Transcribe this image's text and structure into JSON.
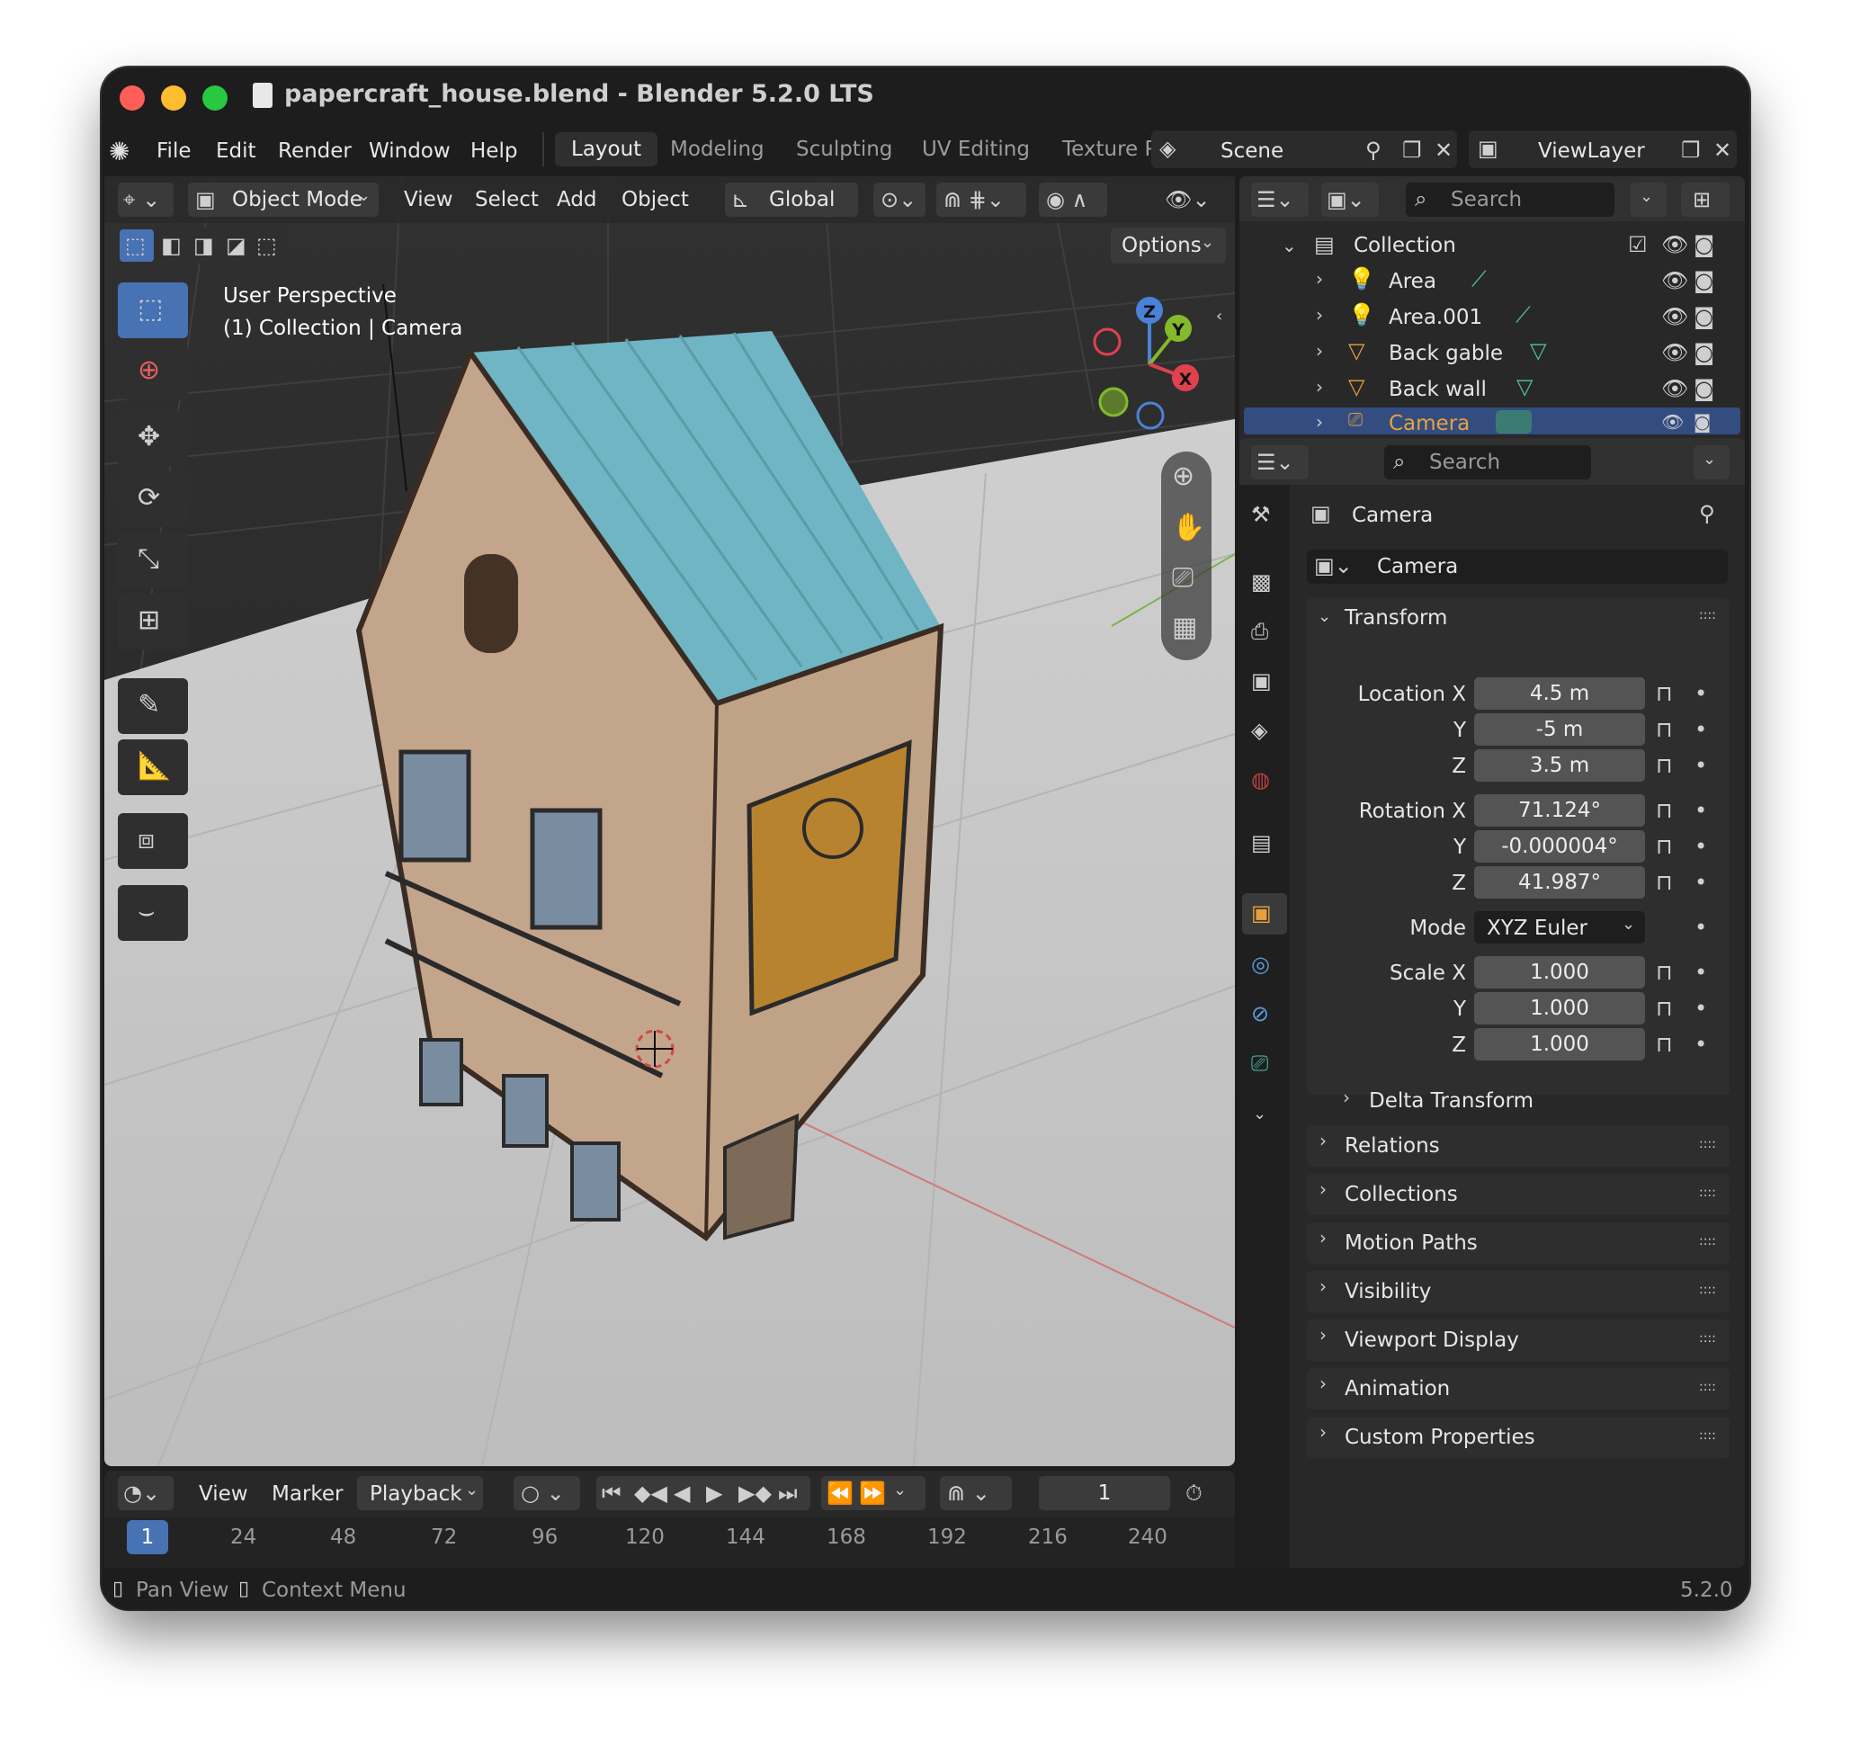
{
  "window": {
    "title": "papercraft_house.blend - Blender 5.2.0 LTS"
  },
  "menu": {
    "items": [
      "File",
      "Edit",
      "Render",
      "Window",
      "Help"
    ]
  },
  "workspaces": {
    "tabs": [
      "Layout",
      "Modeling",
      "Sculpting",
      "UV Editing",
      "Texture P"
    ],
    "active": "Layout"
  },
  "scene": {
    "name": "Scene"
  },
  "view_layer": {
    "name": "ViewLayer"
  },
  "viewport": {
    "mode": "Object Mode",
    "menus": [
      "View",
      "Select",
      "Add",
      "Object"
    ],
    "orientation": "Global",
    "options_label": "Options",
    "overlay_line1": "User Perspective",
    "overlay_line2": "(1) Collection | Camera",
    "gizmo": {
      "x": "X",
      "y": "Y",
      "z": "Z"
    }
  },
  "outliner": {
    "search_placeholder": "Search",
    "collection": "Collection",
    "items": [
      {
        "name": "Area",
        "type": "light"
      },
      {
        "name": "Area.001",
        "type": "light"
      },
      {
        "name": "Back gable",
        "type": "mesh"
      },
      {
        "name": "Back wall",
        "type": "mesh"
      },
      {
        "name": "Camera",
        "type": "camera",
        "selected": true
      }
    ]
  },
  "properties": {
    "search_placeholder": "Search",
    "object_name": "Camera",
    "datablock": "Camera",
    "transform": {
      "header": "Transform",
      "location_label": "Location X",
      "location": [
        "4.5 m",
        "-5 m",
        "3.5 m"
      ],
      "rotation_label": "Rotation X",
      "rotation": [
        "71.124°",
        "-0.000004°",
        "41.987°"
      ],
      "mode_label": "Mode",
      "mode": "XYZ Euler",
      "scale_label": "Scale X",
      "scale": [
        "1.000",
        "1.000",
        "1.000"
      ],
      "y_label": "Y",
      "z_label": "Z",
      "delta": "Delta Transform"
    },
    "sections": [
      "Relations",
      "Collections",
      "Motion Paths",
      "Visibility",
      "Viewport Display",
      "Animation",
      "Custom Properties"
    ]
  },
  "timeline": {
    "menus": [
      "View",
      "Marker"
    ],
    "playback": "Playback",
    "current_frame": "1",
    "playhead": "1",
    "ticks": [
      "24",
      "48",
      "72",
      "96",
      "120",
      "144",
      "168",
      "192",
      "216",
      "240"
    ]
  },
  "statusbar": {
    "hint1": "Pan View",
    "hint2": "Context Menu",
    "version": "5.2.0"
  },
  "colors": {
    "accent_blue": "#4772b3",
    "selection": "#334d80",
    "roof": "#6fb5c3",
    "wall": "#c9a888",
    "x_axis": "#e0414f",
    "y_axis": "#83b92b",
    "z_axis": "#4a82d8"
  }
}
